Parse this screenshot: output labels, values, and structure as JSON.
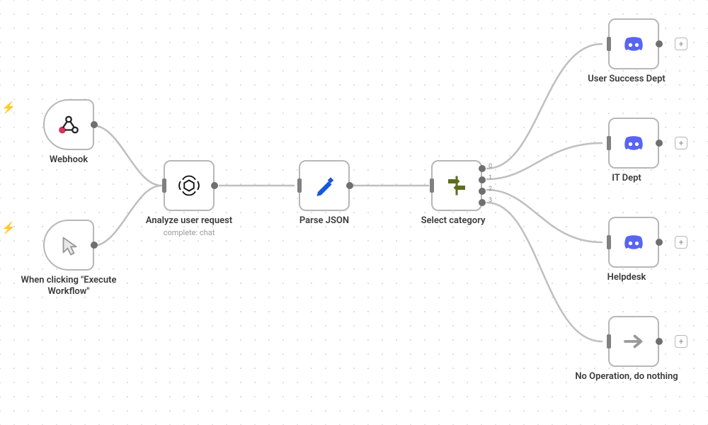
{
  "nodes": {
    "webhook": {
      "label": "Webhook"
    },
    "manual": {
      "label": "When clicking \"Execute Workflow\""
    },
    "analyze": {
      "label": "Analyze user request",
      "sublabel": "complete: chat"
    },
    "parse": {
      "label": "Parse JSON"
    },
    "select": {
      "label": "Select category",
      "outputs": [
        "0",
        "1",
        "2",
        "3"
      ]
    },
    "dept0": {
      "label": "User Success Dept"
    },
    "dept1": {
      "label": "IT Dept"
    },
    "dept2": {
      "label": "Helpdesk"
    },
    "noop": {
      "label": "No Operation, do nothing"
    }
  },
  "colors": {
    "webhook": "#d6345a",
    "pencil": "#1658e0",
    "signpost": "#5c6f1f",
    "discord": "#5865F2",
    "arrow": "#9a9a9a"
  }
}
